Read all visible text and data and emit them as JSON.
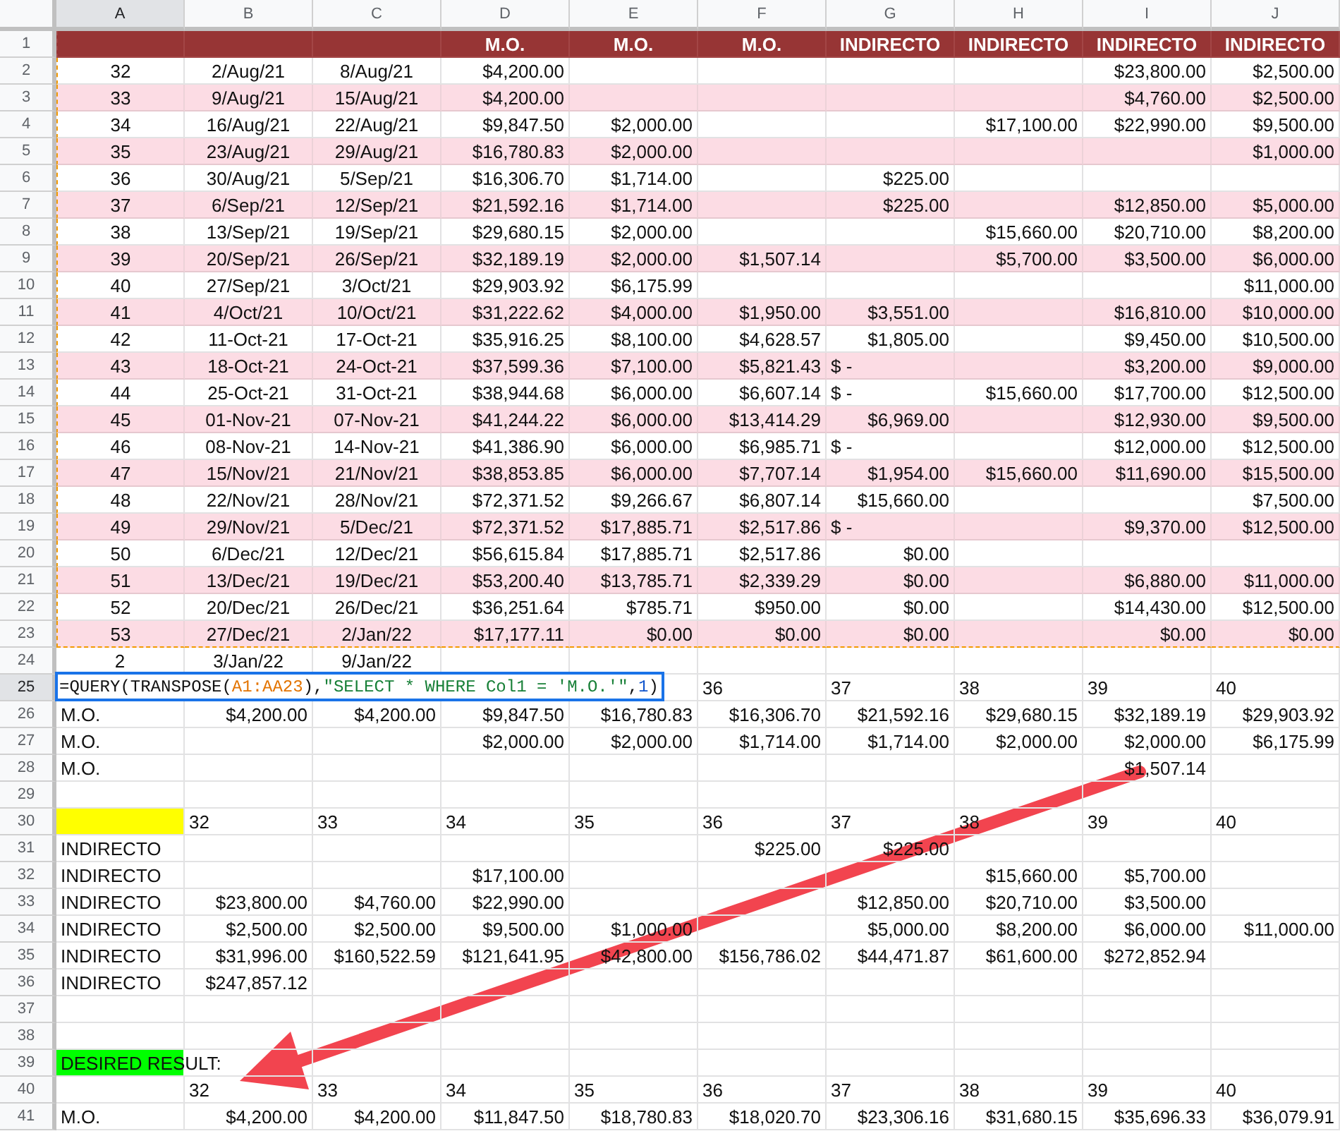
{
  "columns": [
    {
      "label": "A",
      "selected": true
    },
    {
      "label": "B",
      "selected": false
    },
    {
      "label": "C",
      "selected": false
    },
    {
      "label": "D",
      "selected": false
    },
    {
      "label": "E",
      "selected": false
    },
    {
      "label": "F",
      "selected": false
    },
    {
      "label": "G",
      "selected": false
    },
    {
      "label": "H",
      "selected": false
    },
    {
      "label": "I",
      "selected": false
    },
    {
      "label": "J",
      "selected": false
    }
  ],
  "rows": [
    {
      "number": "1",
      "selected": false,
      "kind": "header",
      "copied": true,
      "cells": {
        "D": {
          "text": "M.O.",
          "kind": "centered"
        },
        "E": {
          "text": "M.O.",
          "kind": "centered"
        },
        "F": {
          "text": "M.O.",
          "kind": "centered"
        },
        "G": {
          "text": "INDIRECTO",
          "kind": "centered"
        },
        "H": {
          "text": "INDIRECTO",
          "kind": "centered"
        },
        "I": {
          "text": "INDIRECTO",
          "kind": "centered"
        },
        "J": {
          "text": "INDIRECTO",
          "kind": "centered"
        }
      }
    },
    {
      "number": "2",
      "selected": false,
      "kind": "plain",
      "copied": true,
      "cells": {
        "A": {
          "text": "32",
          "kind": "centered"
        },
        "B": {
          "text": "2/Aug/21",
          "kind": "centered"
        },
        "C": {
          "text": "8/Aug/21",
          "kind": "centered"
        },
        "D": {
          "text": "$4,200.00",
          "kind": "amount"
        },
        "I": {
          "text": "$23,800.00",
          "kind": "amount"
        },
        "J": {
          "text": "$2,500.00",
          "kind": "amount"
        }
      }
    },
    {
      "number": "3",
      "selected": false,
      "kind": "band",
      "copied": true,
      "cells": {
        "A": {
          "text": "33",
          "kind": "centered"
        },
        "B": {
          "text": "9/Aug/21",
          "kind": "centered"
        },
        "C": {
          "text": "15/Aug/21",
          "kind": "centered"
        },
        "D": {
          "text": "$4,200.00",
          "kind": "amount"
        },
        "I": {
          "text": "$4,760.00",
          "kind": "amount"
        },
        "J": {
          "text": "$2,500.00",
          "kind": "amount"
        }
      }
    },
    {
      "number": "4",
      "selected": false,
      "kind": "plain",
      "copied": true,
      "cells": {
        "A": {
          "text": "34",
          "kind": "centered"
        },
        "B": {
          "text": "16/Aug/21",
          "kind": "centered"
        },
        "C": {
          "text": "22/Aug/21",
          "kind": "centered"
        },
        "D": {
          "text": "$9,847.50",
          "kind": "amount"
        },
        "E": {
          "text": "$2,000.00",
          "kind": "amount"
        },
        "H": {
          "text": "$17,100.00",
          "kind": "amount"
        },
        "I": {
          "text": "$22,990.00",
          "kind": "amount"
        },
        "J": {
          "text": "$9,500.00",
          "kind": "amount"
        }
      }
    },
    {
      "number": "5",
      "selected": false,
      "kind": "band",
      "copied": true,
      "cells": {
        "A": {
          "text": "35",
          "kind": "centered"
        },
        "B": {
          "text": "23/Aug/21",
          "kind": "centered"
        },
        "C": {
          "text": "29/Aug/21",
          "kind": "centered"
        },
        "D": {
          "text": "$16,780.83",
          "kind": "amount"
        },
        "E": {
          "text": "$2,000.00",
          "kind": "amount"
        },
        "J": {
          "text": "$1,000.00",
          "kind": "amount"
        }
      }
    },
    {
      "number": "6",
      "selected": false,
      "kind": "plain",
      "copied": true,
      "cells": {
        "A": {
          "text": "36",
          "kind": "centered"
        },
        "B": {
          "text": "30/Aug/21",
          "kind": "centered"
        },
        "C": {
          "text": "5/Sep/21",
          "kind": "centered"
        },
        "D": {
          "text": "$16,306.70",
          "kind": "amount"
        },
        "E": {
          "text": "$1,714.00",
          "kind": "amount"
        },
        "G": {
          "text": "$225.00",
          "kind": "amount"
        }
      }
    },
    {
      "number": "7",
      "selected": false,
      "kind": "band",
      "copied": true,
      "cells": {
        "A": {
          "text": "37",
          "kind": "centered"
        },
        "B": {
          "text": "6/Sep/21",
          "kind": "centered"
        },
        "C": {
          "text": "12/Sep/21",
          "kind": "centered"
        },
        "D": {
          "text": "$21,592.16",
          "kind": "amount"
        },
        "E": {
          "text": "$1,714.00",
          "kind": "amount"
        },
        "G": {
          "text": "$225.00",
          "kind": "amount"
        },
        "I": {
          "text": "$12,850.00",
          "kind": "amount"
        },
        "J": {
          "text": "$5,000.00",
          "kind": "amount"
        }
      }
    },
    {
      "number": "8",
      "selected": false,
      "kind": "plain",
      "copied": true,
      "cells": {
        "A": {
          "text": "38",
          "kind": "centered"
        },
        "B": {
          "text": "13/Sep/21",
          "kind": "centered"
        },
        "C": {
          "text": "19/Sep/21",
          "kind": "centered"
        },
        "D": {
          "text": "$29,680.15",
          "kind": "amount"
        },
        "E": {
          "text": "$2,000.00",
          "kind": "amount"
        },
        "H": {
          "text": "$15,660.00",
          "kind": "amount"
        },
        "I": {
          "text": "$20,710.00",
          "kind": "amount"
        },
        "J": {
          "text": "$8,200.00",
          "kind": "amount"
        }
      }
    },
    {
      "number": "9",
      "selected": false,
      "kind": "band",
      "copied": true,
      "cells": {
        "A": {
          "text": "39",
          "kind": "centered"
        },
        "B": {
          "text": "20/Sep/21",
          "kind": "centered"
        },
        "C": {
          "text": "26/Sep/21",
          "kind": "centered"
        },
        "D": {
          "text": "$32,189.19",
          "kind": "amount"
        },
        "E": {
          "text": "$2,000.00",
          "kind": "amount"
        },
        "F": {
          "text": "$1,507.14",
          "kind": "amount"
        },
        "H": {
          "text": "$5,700.00",
          "kind": "amount"
        },
        "I": {
          "text": "$3,500.00",
          "kind": "amount"
        },
        "J": {
          "text": "$6,000.00",
          "kind": "amount"
        }
      }
    },
    {
      "number": "10",
      "selected": false,
      "kind": "plain",
      "copied": true,
      "cells": {
        "A": {
          "text": "40",
          "kind": "centered"
        },
        "B": {
          "text": "27/Sep/21",
          "kind": "centered"
        },
        "C": {
          "text": "3/Oct/21",
          "kind": "centered"
        },
        "D": {
          "text": "$29,903.92",
          "kind": "amount"
        },
        "E": {
          "text": "$6,175.99",
          "kind": "amount"
        },
        "J": {
          "text": "$11,000.00",
          "kind": "amount"
        }
      }
    },
    {
      "number": "11",
      "selected": false,
      "kind": "band",
      "copied": true,
      "cells": {
        "A": {
          "text": "41",
          "kind": "centered"
        },
        "B": {
          "text": "4/Oct/21",
          "kind": "centered"
        },
        "C": {
          "text": "10/Oct/21",
          "kind": "centered"
        },
        "D": {
          "text": "$31,222.62",
          "kind": "amount"
        },
        "E": {
          "text": "$4,000.00",
          "kind": "amount"
        },
        "F": {
          "text": "$1,950.00",
          "kind": "amount"
        },
        "G": {
          "text": "$3,551.00",
          "kind": "amount"
        },
        "I": {
          "text": "$16,810.00",
          "kind": "amount"
        },
        "J": {
          "text": "$10,000.00",
          "kind": "amount"
        }
      }
    },
    {
      "number": "12",
      "selected": false,
      "kind": "plain",
      "copied": true,
      "cells": {
        "A": {
          "text": "42",
          "kind": "centered"
        },
        "B": {
          "text": "11-Oct-21",
          "kind": "centered"
        },
        "C": {
          "text": "17-Oct-21",
          "kind": "centered"
        },
        "D": {
          "text": "$35,916.25",
          "kind": "amount"
        },
        "E": {
          "text": "$8,100.00",
          "kind": "amount"
        },
        "F": {
          "text": "$4,628.57",
          "kind": "amount"
        },
        "G": {
          "text": "$1,805.00",
          "kind": "amount"
        },
        "I": {
          "text": "$9,450.00",
          "kind": "amount"
        },
        "J": {
          "text": "$10,500.00",
          "kind": "amount"
        }
      }
    },
    {
      "number": "13",
      "selected": false,
      "kind": "band",
      "copied": true,
      "cells": {
        "A": {
          "text": "43",
          "kind": "centered"
        },
        "B": {
          "text": "18-Oct-21",
          "kind": "centered"
        },
        "C": {
          "text": "24-Oct-21",
          "kind": "centered"
        },
        "D": {
          "text": "$37,599.36",
          "kind": "amount"
        },
        "E": {
          "text": "$7,100.00",
          "kind": "amount"
        },
        "F": {
          "text": "$5,821.43",
          "kind": "amount"
        },
        "G": {
          "text": "$ -",
          "kind": "label"
        },
        "I": {
          "text": "$3,200.00",
          "kind": "amount"
        },
        "J": {
          "text": "$9,000.00",
          "kind": "amount"
        }
      }
    },
    {
      "number": "14",
      "selected": false,
      "kind": "plain",
      "copied": true,
      "cells": {
        "A": {
          "text": "44",
          "kind": "centered"
        },
        "B": {
          "text": "25-Oct-21",
          "kind": "centered"
        },
        "C": {
          "text": "31-Oct-21",
          "kind": "centered"
        },
        "D": {
          "text": "$38,944.68",
          "kind": "amount"
        },
        "E": {
          "text": "$6,000.00",
          "kind": "amount"
        },
        "F": {
          "text": "$6,607.14",
          "kind": "amount"
        },
        "G": {
          "text": "$ -",
          "kind": "label"
        },
        "H": {
          "text": "$15,660.00",
          "kind": "amount"
        },
        "I": {
          "text": "$17,700.00",
          "kind": "amount"
        },
        "J": {
          "text": "$12,500.00",
          "kind": "amount"
        }
      }
    },
    {
      "number": "15",
      "selected": false,
      "kind": "band",
      "copied": true,
      "cells": {
        "A": {
          "text": "45",
          "kind": "centered"
        },
        "B": {
          "text": "01-Nov-21",
          "kind": "centered"
        },
        "C": {
          "text": "07-Nov-21",
          "kind": "centered"
        },
        "D": {
          "text": "$41,244.22",
          "kind": "amount"
        },
        "E": {
          "text": "$6,000.00",
          "kind": "amount"
        },
        "F": {
          "text": "$13,414.29",
          "kind": "amount"
        },
        "G": {
          "text": "$6,969.00",
          "kind": "amount"
        },
        "I": {
          "text": "$12,930.00",
          "kind": "amount"
        },
        "J": {
          "text": "$9,500.00",
          "kind": "amount"
        }
      }
    },
    {
      "number": "16",
      "selected": false,
      "kind": "plain",
      "copied": true,
      "cells": {
        "A": {
          "text": "46",
          "kind": "centered"
        },
        "B": {
          "text": "08-Nov-21",
          "kind": "centered"
        },
        "C": {
          "text": "14-Nov-21",
          "kind": "centered"
        },
        "D": {
          "text": "$41,386.90",
          "kind": "amount"
        },
        "E": {
          "text": "$6,000.00",
          "kind": "amount"
        },
        "F": {
          "text": "$6,985.71",
          "kind": "amount"
        },
        "G": {
          "text": "$ -",
          "kind": "label"
        },
        "I": {
          "text": "$12,000.00",
          "kind": "amount"
        },
        "J": {
          "text": "$12,500.00",
          "kind": "amount"
        }
      }
    },
    {
      "number": "17",
      "selected": false,
      "kind": "band",
      "copied": true,
      "cells": {
        "A": {
          "text": "47",
          "kind": "centered"
        },
        "B": {
          "text": "15/Nov/21",
          "kind": "centered"
        },
        "C": {
          "text": "21/Nov/21",
          "kind": "centered"
        },
        "D": {
          "text": "$38,853.85",
          "kind": "amount"
        },
        "E": {
          "text": "$6,000.00",
          "kind": "amount"
        },
        "F": {
          "text": "$7,707.14",
          "kind": "amount"
        },
        "G": {
          "text": "$1,954.00",
          "kind": "amount"
        },
        "H": {
          "text": "$15,660.00",
          "kind": "amount"
        },
        "I": {
          "text": "$11,690.00",
          "kind": "amount"
        },
        "J": {
          "text": "$15,500.00",
          "kind": "amount"
        }
      }
    },
    {
      "number": "18",
      "selected": false,
      "kind": "plain",
      "copied": true,
      "cells": {
        "A": {
          "text": "48",
          "kind": "centered"
        },
        "B": {
          "text": "22/Nov/21",
          "kind": "centered"
        },
        "C": {
          "text": "28/Nov/21",
          "kind": "centered"
        },
        "D": {
          "text": "$72,371.52",
          "kind": "amount"
        },
        "E": {
          "text": "$9,266.67",
          "kind": "amount"
        },
        "F": {
          "text": "$6,807.14",
          "kind": "amount"
        },
        "G": {
          "text": "$15,660.00",
          "kind": "amount"
        },
        "J": {
          "text": "$7,500.00",
          "kind": "amount"
        }
      }
    },
    {
      "number": "19",
      "selected": false,
      "kind": "band",
      "copied": true,
      "cells": {
        "A": {
          "text": "49",
          "kind": "centered"
        },
        "B": {
          "text": "29/Nov/21",
          "kind": "centered"
        },
        "C": {
          "text": "5/Dec/21",
          "kind": "centered"
        },
        "D": {
          "text": "$72,371.52",
          "kind": "amount"
        },
        "E": {
          "text": "$17,885.71",
          "kind": "amount"
        },
        "F": {
          "text": "$2,517.86",
          "kind": "amount"
        },
        "G": {
          "text": "$ -",
          "kind": "label"
        },
        "I": {
          "text": "$9,370.00",
          "kind": "amount"
        },
        "J": {
          "text": "$12,500.00",
          "kind": "amount"
        }
      }
    },
    {
      "number": "20",
      "selected": false,
      "kind": "plain",
      "copied": true,
      "cells": {
        "A": {
          "text": "50",
          "kind": "centered"
        },
        "B": {
          "text": "6/Dec/21",
          "kind": "centered"
        },
        "C": {
          "text": "12/Dec/21",
          "kind": "centered"
        },
        "D": {
          "text": "$56,615.84",
          "kind": "amount"
        },
        "E": {
          "text": "$17,885.71",
          "kind": "amount"
        },
        "F": {
          "text": "$2,517.86",
          "kind": "amount"
        },
        "G": {
          "text": "$0.00",
          "kind": "amount"
        }
      }
    },
    {
      "number": "21",
      "selected": false,
      "kind": "band",
      "copied": true,
      "cells": {
        "A": {
          "text": "51",
          "kind": "centered"
        },
        "B": {
          "text": "13/Dec/21",
          "kind": "centered"
        },
        "C": {
          "text": "19/Dec/21",
          "kind": "centered"
        },
        "D": {
          "text": "$53,200.40",
          "kind": "amount"
        },
        "E": {
          "text": "$13,785.71",
          "kind": "amount"
        },
        "F": {
          "text": "$2,339.29",
          "kind": "amount"
        },
        "G": {
          "text": "$0.00",
          "kind": "amount"
        },
        "I": {
          "text": "$6,880.00",
          "kind": "amount"
        },
        "J": {
          "text": "$11,000.00",
          "kind": "amount"
        }
      }
    },
    {
      "number": "22",
      "selected": false,
      "kind": "plain",
      "copied": true,
      "cells": {
        "A": {
          "text": "52",
          "kind": "centered"
        },
        "B": {
          "text": "20/Dec/21",
          "kind": "centered"
        },
        "C": {
          "text": "26/Dec/21",
          "kind": "centered"
        },
        "D": {
          "text": "$36,251.64",
          "kind": "amount"
        },
        "E": {
          "text": "$785.71",
          "kind": "amount"
        },
        "F": {
          "text": "$950.00",
          "kind": "amount"
        },
        "G": {
          "text": "$0.00",
          "kind": "amount"
        },
        "I": {
          "text": "$14,430.00",
          "kind": "amount"
        },
        "J": {
          "text": "$12,500.00",
          "kind": "amount"
        }
      }
    },
    {
      "number": "23",
      "selected": false,
      "kind": "band",
      "copied": true,
      "cells": {
        "A": {
          "text": "53",
          "kind": "centered"
        },
        "B": {
          "text": "27/Dec/21",
          "kind": "centered"
        },
        "C": {
          "text": "2/Jan/22",
          "kind": "centered"
        },
        "D": {
          "text": "$17,177.11",
          "kind": "amount"
        },
        "E": {
          "text": "$0.00",
          "kind": "amount"
        },
        "F": {
          "text": "$0.00",
          "kind": "amount"
        },
        "G": {
          "text": "$0.00",
          "kind": "amount"
        },
        "I": {
          "text": "$0.00",
          "kind": "amount"
        },
        "J": {
          "text": "$0.00",
          "kind": "amount"
        }
      }
    },
    {
      "number": "24",
      "selected": false,
      "kind": "plain",
      "copied": false,
      "cells": {
        "A": {
          "text": "2",
          "kind": "centered"
        },
        "B": {
          "text": "3/Jan/22",
          "kind": "centered"
        },
        "C": {
          "text": "9/Jan/22",
          "kind": "centered"
        }
      }
    },
    {
      "number": "25",
      "selected": true,
      "kind": "plain",
      "copied": false,
      "editor": {
        "parts": [
          {
            "kind": "plain",
            "text": "=QUERY(TRANSPOSE("
          },
          {
            "kind": "range",
            "text": "A1:AA23"
          },
          {
            "kind": "plain",
            "text": "),"
          },
          {
            "kind": "string",
            "text": "\"SELECT * WHERE Col1 = 'M.O.'\""
          },
          {
            "kind": "plain",
            "text": ","
          },
          {
            "kind": "number",
            "text": "1"
          },
          {
            "kind": "plain",
            "text": ")"
          }
        ]
      },
      "cells": {
        "F": {
          "text": "36",
          "kind": "label"
        },
        "G": {
          "text": "37",
          "kind": "label"
        },
        "H": {
          "text": "38",
          "kind": "label"
        },
        "I": {
          "text": "39",
          "kind": "label"
        },
        "J": {
          "text": "40",
          "kind": "label"
        }
      }
    },
    {
      "number": "26",
      "selected": false,
      "kind": "plain",
      "copied": false,
      "cells": {
        "A": {
          "text": "M.O.",
          "kind": "label"
        },
        "B": {
          "text": "$4,200.00",
          "kind": "amount"
        },
        "C": {
          "text": "$4,200.00",
          "kind": "amount"
        },
        "D": {
          "text": "$9,847.50",
          "kind": "amount"
        },
        "E": {
          "text": "$16,780.83",
          "kind": "amount"
        },
        "F": {
          "text": "$16,306.70",
          "kind": "amount"
        },
        "G": {
          "text": "$21,592.16",
          "kind": "amount"
        },
        "H": {
          "text": "$29,680.15",
          "kind": "amount"
        },
        "I": {
          "text": "$32,189.19",
          "kind": "amount"
        },
        "J": {
          "text": "$29,903.92",
          "kind": "amount"
        }
      }
    },
    {
      "number": "27",
      "selected": false,
      "kind": "plain",
      "copied": false,
      "cells": {
        "A": {
          "text": "M.O.",
          "kind": "label"
        },
        "D": {
          "text": "$2,000.00",
          "kind": "amount"
        },
        "E": {
          "text": "$2,000.00",
          "kind": "amount"
        },
        "F": {
          "text": "$1,714.00",
          "kind": "amount"
        },
        "G": {
          "text": "$1,714.00",
          "kind": "amount"
        },
        "H": {
          "text": "$2,000.00",
          "kind": "amount"
        },
        "I": {
          "text": "$2,000.00",
          "kind": "amount"
        },
        "J": {
          "text": "$6,175.99",
          "kind": "amount"
        }
      }
    },
    {
      "number": "28",
      "selected": false,
      "kind": "plain",
      "copied": false,
      "cells": {
        "A": {
          "text": "M.O.",
          "kind": "label"
        },
        "I": {
          "text": "$1,507.14",
          "kind": "amount"
        }
      }
    },
    {
      "number": "29",
      "selected": false,
      "kind": "plain",
      "copied": false,
      "cells": {}
    },
    {
      "number": "30",
      "selected": false,
      "kind": "plain",
      "copied": false,
      "cells": {
        "A": {
          "color": "#ffff00",
          "kind": "label"
        },
        "B": {
          "text": "32",
          "kind": "label"
        },
        "C": {
          "text": "33",
          "kind": "label"
        },
        "D": {
          "text": "34",
          "kind": "label"
        },
        "E": {
          "text": "35",
          "kind": "label"
        },
        "F": {
          "text": "36",
          "kind": "label"
        },
        "G": {
          "text": "37",
          "kind": "label"
        },
        "H": {
          "text": "38",
          "kind": "label"
        },
        "I": {
          "text": "39",
          "kind": "label"
        },
        "J": {
          "text": "40",
          "kind": "label"
        }
      }
    },
    {
      "number": "31",
      "selected": false,
      "kind": "plain",
      "copied": false,
      "cells": {
        "A": {
          "text": "INDIRECTO",
          "kind": "label"
        },
        "F": {
          "text": "$225.00",
          "kind": "amount"
        },
        "G": {
          "text": "$225.00",
          "kind": "amount"
        }
      }
    },
    {
      "number": "32",
      "selected": false,
      "kind": "plain",
      "copied": false,
      "cells": {
        "A": {
          "text": "INDIRECTO",
          "kind": "label"
        },
        "D": {
          "text": "$17,100.00",
          "kind": "amount"
        },
        "H": {
          "text": "$15,660.00",
          "kind": "amount"
        },
        "I": {
          "text": "$5,700.00",
          "kind": "amount"
        }
      }
    },
    {
      "number": "33",
      "selected": false,
      "kind": "plain",
      "copied": false,
      "cells": {
        "A": {
          "text": "INDIRECTO",
          "kind": "label"
        },
        "B": {
          "text": "$23,800.00",
          "kind": "amount"
        },
        "C": {
          "text": "$4,760.00",
          "kind": "amount"
        },
        "D": {
          "text": "$22,990.00",
          "kind": "amount"
        },
        "G": {
          "text": "$12,850.00",
          "kind": "amount"
        },
        "H": {
          "text": "$20,710.00",
          "kind": "amount"
        },
        "I": {
          "text": "$3,500.00",
          "kind": "amount"
        }
      }
    },
    {
      "number": "34",
      "selected": false,
      "kind": "plain",
      "copied": false,
      "cells": {
        "A": {
          "text": "INDIRECTO",
          "kind": "label"
        },
        "B": {
          "text": "$2,500.00",
          "kind": "amount"
        },
        "C": {
          "text": "$2,500.00",
          "kind": "amount"
        },
        "D": {
          "text": "$9,500.00",
          "kind": "amount"
        },
        "E": {
          "text": "$1,000.00",
          "kind": "amount"
        },
        "G": {
          "text": "$5,000.00",
          "kind": "amount"
        },
        "H": {
          "text": "$8,200.00",
          "kind": "amount"
        },
        "I": {
          "text": "$6,000.00",
          "kind": "amount"
        },
        "J": {
          "text": "$11,000.00",
          "kind": "amount"
        }
      }
    },
    {
      "number": "35",
      "selected": false,
      "kind": "plain",
      "copied": false,
      "cells": {
        "A": {
          "text": "INDIRECTO",
          "kind": "label"
        },
        "B": {
          "text": "$31,996.00",
          "kind": "amount"
        },
        "C": {
          "text": "$160,522.59",
          "kind": "amount"
        },
        "D": {
          "text": "$121,641.95",
          "kind": "amount"
        },
        "E": {
          "text": "$42,800.00",
          "kind": "amount"
        },
        "F": {
          "text": "$156,786.02",
          "kind": "amount"
        },
        "G": {
          "text": "$44,471.87",
          "kind": "amount"
        },
        "H": {
          "text": "$61,600.00",
          "kind": "amount"
        },
        "I": {
          "text": "$272,852.94",
          "kind": "amount"
        }
      }
    },
    {
      "number": "36",
      "selected": false,
      "kind": "plain",
      "copied": false,
      "cells": {
        "A": {
          "text": "INDIRECTO",
          "kind": "label"
        },
        "B": {
          "text": "$247,857.12",
          "kind": "amount"
        }
      }
    },
    {
      "number": "37",
      "selected": false,
      "kind": "plain",
      "copied": false,
      "cells": {}
    },
    {
      "number": "38",
      "selected": false,
      "kind": "plain",
      "copied": false,
      "cells": {}
    },
    {
      "number": "39",
      "selected": false,
      "kind": "plain",
      "copied": false,
      "cells": {
        "A": {
          "text": "DESIRED RESULT:",
          "color": "#00ff00",
          "kind": "overflow"
        }
      }
    },
    {
      "number": "40",
      "selected": false,
      "kind": "plain",
      "copied": false,
      "cells": {
        "B": {
          "text": "32",
          "kind": "label"
        },
        "C": {
          "text": "33",
          "kind": "label"
        },
        "D": {
          "text": "34",
          "kind": "label"
        },
        "E": {
          "text": "35",
          "kind": "label"
        },
        "F": {
          "text": "36",
          "kind": "label"
        },
        "G": {
          "text": "37",
          "kind": "label"
        },
        "H": {
          "text": "38",
          "kind": "label"
        },
        "I": {
          "text": "39",
          "kind": "label"
        },
        "J": {
          "text": "40",
          "kind": "label"
        }
      }
    },
    {
      "number": "41",
      "selected": false,
      "kind": "plain",
      "copied": false,
      "cells": {
        "A": {
          "text": "M.O.",
          "kind": "label"
        },
        "B": {
          "text": "$4,200.00",
          "kind": "amount"
        },
        "C": {
          "text": "$4,200.00",
          "kind": "amount"
        },
        "D": {
          "text": "$11,847.50",
          "kind": "amount"
        },
        "E": {
          "text": "$18,780.83",
          "kind": "amount"
        },
        "F": {
          "text": "$18,020.70",
          "kind": "amount"
        },
        "G": {
          "text": "$23,306.16",
          "kind": "amount"
        },
        "H": {
          "text": "$31,680.15",
          "kind": "amount"
        },
        "I": {
          "text": "$35,696.33",
          "kind": "amount"
        },
        "J": {
          "text": "$36,079.91",
          "kind": "amount"
        }
      }
    }
  ]
}
